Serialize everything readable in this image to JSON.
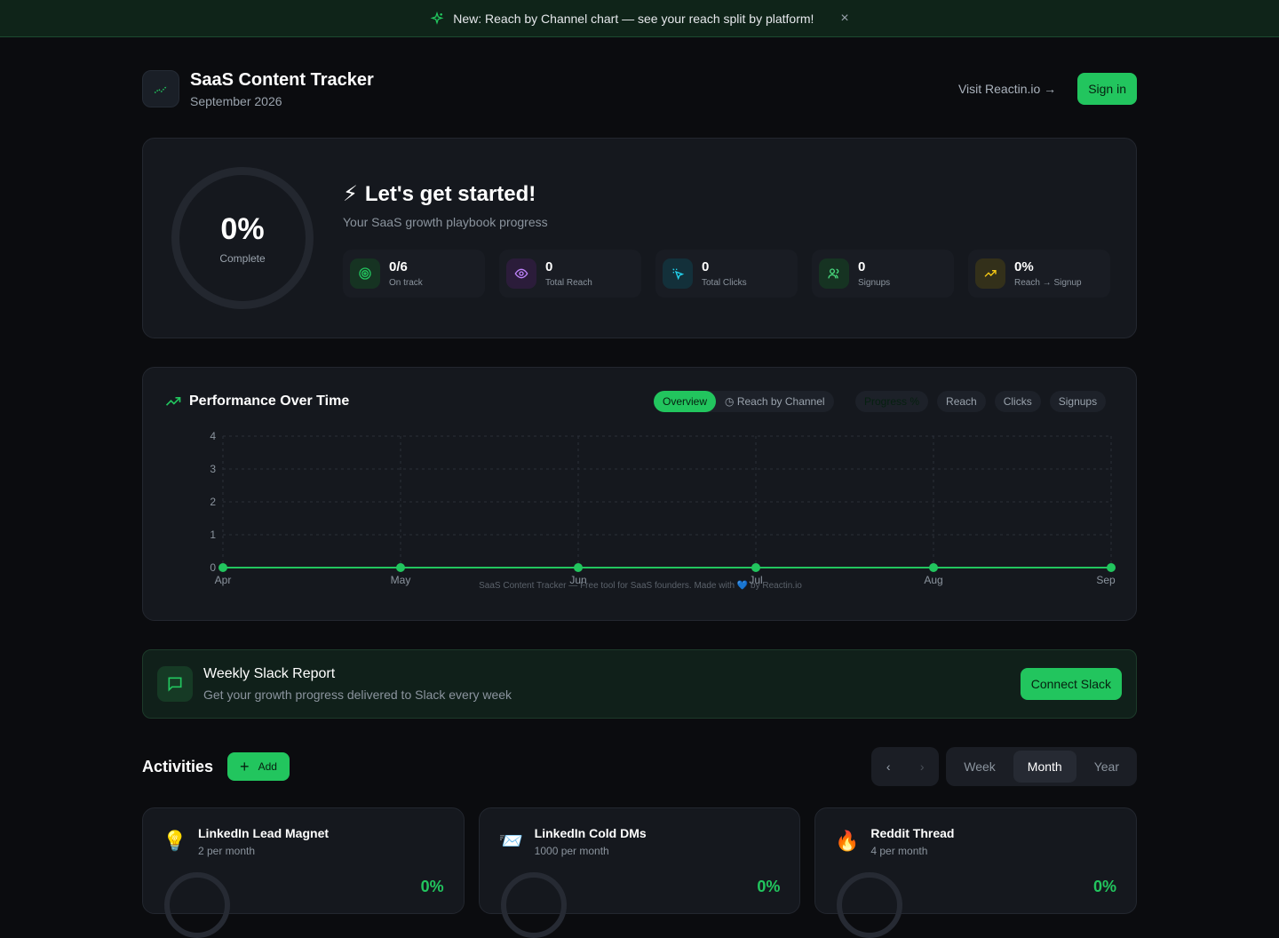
{
  "banner": {
    "text": "New: Reach by Channel chart — see your reach split by platform!",
    "close": "×"
  },
  "header": {
    "title": "SaaS Content Tracker",
    "subtitle": "September 2026",
    "visit_link": "Visit Reactin.io →",
    "signin": "Sign in"
  },
  "hero": {
    "percent": "0%",
    "percent_label": "Complete",
    "title": "Let's get started!",
    "subtitle": "Your SaaS growth playbook progress",
    "stats": [
      {
        "value": "0/6",
        "label": "On track",
        "icon": "target-icon",
        "color": "#22c55e"
      },
      {
        "value": "0",
        "label": "Total Reach",
        "icon": "eye-icon",
        "color": "#c084fc"
      },
      {
        "value": "0",
        "label": "Total Clicks",
        "icon": "cursor-click-icon",
        "color": "#22d3ee"
      },
      {
        "value": "0",
        "label": "Signups",
        "icon": "users-icon",
        "color": "#4ade80"
      },
      {
        "value": "0%",
        "label": "Reach → Signup",
        "icon": "trending-up-icon",
        "color": "#facc15"
      }
    ]
  },
  "performance": {
    "title": "Performance Over Time",
    "view_tabs": [
      "Overview",
      "Reach by Channel"
    ],
    "metric_tabs": [
      "Progress %",
      "Reach",
      "Clicks",
      "Signups"
    ],
    "footer": "SaaS Content Tracker — Free tool for SaaS founders. Made with 💙 by Reactin.io"
  },
  "chart_data": {
    "type": "line",
    "x": [
      "Apr",
      "May",
      "Jun",
      "Jul",
      "Aug",
      "Sep"
    ],
    "series": [
      {
        "values": [
          0,
          0,
          0,
          0,
          0,
          0
        ]
      }
    ],
    "yticks": [
      0,
      1,
      2,
      3,
      4
    ],
    "ylim": [
      0,
      4
    ],
    "grid": true,
    "color": "#22c55e"
  },
  "slack": {
    "title": "Weekly Slack Report",
    "subtitle": "Get your growth progress delivered to Slack every week",
    "button": "Connect Slack"
  },
  "activities": {
    "title": "Activities",
    "add": "Add",
    "prev": "‹",
    "next": "›",
    "periods": [
      "Week",
      "Month",
      "Year"
    ],
    "active_period": "Month",
    "items": [
      {
        "emoji": "💡",
        "name": "LinkedIn Lead Magnet",
        "frequency": "2 per month",
        "percent": "0%"
      },
      {
        "emoji": "📨",
        "name": "LinkedIn Cold DMs",
        "frequency": "1000 per month",
        "percent": "0%"
      },
      {
        "emoji": "🔥",
        "name": "Reddit Thread",
        "frequency": "4 per month",
        "percent": "0%"
      }
    ]
  }
}
